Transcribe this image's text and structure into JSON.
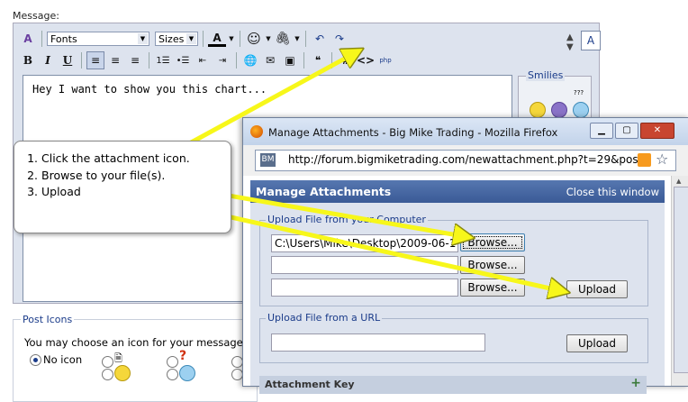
{
  "editor": {
    "message_label": "Message:",
    "font_select": "Fonts",
    "size_select": "Sizes",
    "textarea_value": "Hey I want to show you this chart..."
  },
  "smilies": {
    "legend": "Smilies",
    "more_label": "???"
  },
  "post_icons": {
    "legend": "Post Icons",
    "instruction": "You may choose an icon for your message",
    "no_icon_label": "No icon"
  },
  "callout": {
    "steps": [
      "Click the attachment icon.",
      "Browse to your file(s).",
      "Upload"
    ]
  },
  "firefox": {
    "window_title": "Manage Attachments - Big Mike Trading - Mozilla Firefox",
    "site_badge": "BM",
    "url": "http://forum.bigmiketrading.com/newattachment.php?t=29&posts"
  },
  "manage_attachments": {
    "title": "Manage Attachments",
    "close_link": "Close this window",
    "upload_computer_legend": "Upload File from your Computer",
    "file1_value": "C:\\Users\\Mike\\Desktop\\2009-06-1",
    "file2_value": "",
    "file3_value": "",
    "browse_label": "Browse...",
    "upload_label": "Upload",
    "upload_url_legend": "Upload File from a URL",
    "url_value": "",
    "attachment_key_label": "Attachment Key"
  },
  "colors": {
    "arrow": "#f7f71a",
    "header_blue": "#3a5a96",
    "panel": "#dde3ee",
    "legend_text": "#1b3c8a"
  }
}
